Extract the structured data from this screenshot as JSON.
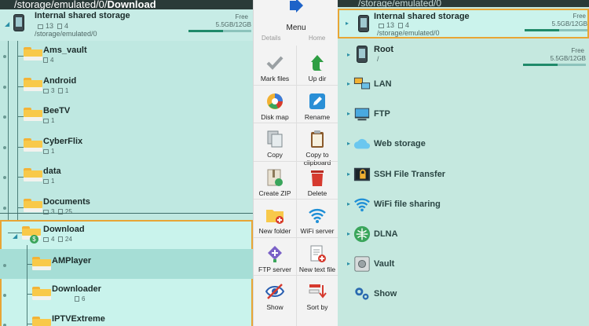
{
  "left": {
    "path_prefix": "/storage/emulated/0/",
    "path_current": "Download",
    "storage": {
      "name": "Internal shared storage",
      "folders": "13",
      "files": "4",
      "path": "/storage/emulated/0",
      "free_label": "Free",
      "free_value": "5.5GB/12GB",
      "used_fraction": 0.55
    },
    "folders": [
      {
        "name": "Ams_vault",
        "folders": "",
        "files": "4"
      },
      {
        "name": "Android",
        "folders": "3",
        "files": "1"
      },
      {
        "name": "BeeTV",
        "folders": "1",
        "files": ""
      },
      {
        "name": "CyberFlix",
        "folders": "1",
        "files": ""
      },
      {
        "name": "data",
        "folders": "1",
        "files": ""
      },
      {
        "name": "Documents",
        "folders": "3",
        "files": "25"
      }
    ],
    "download": {
      "name": "Download",
      "folders": "4",
      "files": "24"
    },
    "children": [
      {
        "name": "AMPlayer",
        "folders": "",
        "files": ""
      },
      {
        "name": "Downloader",
        "folders": "",
        "files": "6"
      },
      {
        "name": "IPTVExtreme",
        "folders": "",
        "files": ""
      }
    ]
  },
  "menu": {
    "title": "Menu",
    "ghost_left": "Details",
    "ghost_right": "Home",
    "items": [
      {
        "label": "Mark files",
        "icon": "check-icon"
      },
      {
        "label": "Up dir",
        "icon": "arrow-up-icon"
      },
      {
        "label": "Disk map",
        "icon": "pie-chart-icon"
      },
      {
        "label": "Rename",
        "icon": "pencil-icon"
      },
      {
        "label": "Copy",
        "icon": "copy-icon"
      },
      {
        "label": "Copy to clipboard",
        "icon": "clipboard-icon"
      },
      {
        "label": "Create ZIP",
        "icon": "zip-icon"
      },
      {
        "label": "Delete",
        "icon": "trash-icon"
      },
      {
        "label": "New folder",
        "icon": "new-folder-icon"
      },
      {
        "label": "WiFi server",
        "icon": "wifi-icon"
      },
      {
        "label": "FTP server",
        "icon": "ftp-server-icon"
      },
      {
        "label": "New text file",
        "icon": "new-text-file-icon"
      },
      {
        "label": "Show",
        "icon": "eye-icon"
      },
      {
        "label": "Sort by",
        "icon": "sort-icon"
      }
    ]
  },
  "right": {
    "path": "/storage/emulated/0",
    "storage": {
      "name": "Internal shared storage",
      "folders": "13",
      "files": "4",
      "path": "/storage/emulated/0",
      "free_label": "Free",
      "free_value": "5.5GB/12GB",
      "used_fraction": 0.55
    },
    "root": {
      "name": "Root",
      "path": "/",
      "free_label": "Free",
      "free_value": "5.5GB/12GB",
      "used_fraction": 0.55
    },
    "items": [
      {
        "label": "LAN",
        "icon": "lan-icon"
      },
      {
        "label": "FTP",
        "icon": "ftp-icon"
      },
      {
        "label": "Web storage",
        "icon": "cloud-icon"
      },
      {
        "label": "SSH File Transfer",
        "icon": "ssh-icon"
      },
      {
        "label": "WiFi file sharing",
        "icon": "wifi-icon"
      },
      {
        "label": "DLNA",
        "icon": "dlna-icon"
      },
      {
        "label": "Vault",
        "icon": "vault-icon"
      },
      {
        "label": "Show",
        "icon": "gears-icon"
      }
    ]
  },
  "colors": {
    "accent_orange": "#e8a535",
    "folder_yellow": "#f8c94a",
    "bar_green": "#1f8a6a",
    "up_green": "#2e9e43",
    "delete_red": "#d63a2f",
    "wifi_blue": "#1f8fd6"
  }
}
